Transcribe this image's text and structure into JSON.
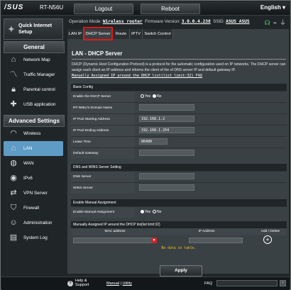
{
  "header": {
    "logo": "/SUS",
    "model": "RT-N56U",
    "logout_label": "Logout",
    "reboot_label": "Reboot",
    "language": "English"
  },
  "status": {
    "op_mode_label": "Operation Mode:",
    "op_mode_value": "Wireless router",
    "firmware_label": "Firmware Version:",
    "firmware_value": "3.0.0.4.238",
    "ssid_label": "SSID:",
    "ssid_value": "ASUS  ASUS"
  },
  "sidebar": {
    "qis_label": "Quick Internet Setup",
    "general_header": "General",
    "general_items": [
      {
        "label": "Network Map",
        "icon": "network-map-icon"
      },
      {
        "label": "Traffic Manager",
        "icon": "traffic-icon"
      },
      {
        "label": "Parental control",
        "icon": "lock-icon"
      },
      {
        "label": "USB application",
        "icon": "puzzle-icon"
      }
    ],
    "advanced_header": "Advanced Settings",
    "advanced_items": [
      {
        "label": "Wireless",
        "icon": "wifi-icon"
      },
      {
        "label": "LAN",
        "icon": "home-icon",
        "active": true
      },
      {
        "label": "WAN",
        "icon": "globe-icon"
      },
      {
        "label": "IPv6",
        "icon": "ipv6-icon"
      },
      {
        "label": "VPN Server",
        "icon": "vpn-icon"
      },
      {
        "label": "Firewall",
        "icon": "shield-icon"
      },
      {
        "label": "Administration",
        "icon": "admin-icon"
      },
      {
        "label": "System Log",
        "icon": "log-icon"
      }
    ]
  },
  "tabs": [
    "LAN IP",
    "DHCP Server",
    "Route",
    "IPTV",
    "Switch Control"
  ],
  "main": {
    "title": "LAN - DHCP Server",
    "description_1": "DHCP (Dynamic Host Configuration Protocol) is a protocol for the automatic configuration used on IP networks. The DHCP server can assign each client an IP address and informs the client of the of DNS server IP and default gateway IP.",
    "description_link": "Manually Assigned IP around the DHCP list(list limit:32) FAQ",
    "basic_config": {
      "header": "Basic Config",
      "enable_label": "Enable the DHCP Server",
      "yes_label": "Yes",
      "no_label": "No",
      "domain_label": "RT-N56U's Domain Name",
      "domain_value": "",
      "start_label": "IP Pool Starting Address",
      "start_value": "192.168.1.2",
      "end_label": "IP Pool Ending Address",
      "end_value": "192.168.1.254",
      "lease_label": "Lease Time",
      "lease_value": "86400",
      "gateway_label": "Default Gateway",
      "gateway_value": ""
    },
    "dns_wins": {
      "header": "DNS and WINS Server Setting",
      "dns_label": "DNS Server",
      "dns_value": "",
      "wins_label": "WINS Server",
      "wins_value": ""
    },
    "manual": {
      "header": "Enable Manual Assignment",
      "enable_label": "Enable Manual Assignment",
      "yes_label": "Yes",
      "no_label": "No"
    },
    "manual_list": {
      "header": "Manually Assigned IP around the DHCP list(list limit:32)",
      "col_mac": "MAC address",
      "col_ip": "IP Address",
      "col_action": "Add / Delete",
      "empty_text": "No data in table."
    },
    "apply_label": "Apply"
  },
  "footer": {
    "help_label": "Help & Support",
    "manual_label": "Manual",
    "utility_label": "Utility",
    "faq_label": "FAQ"
  }
}
